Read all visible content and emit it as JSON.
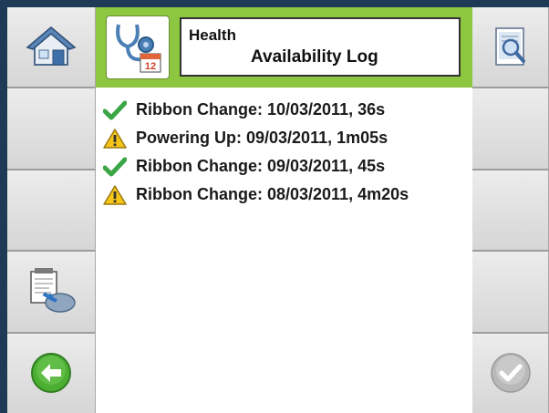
{
  "header": {
    "title_line1": "Health",
    "title_line2": "Availability Log",
    "icon": "stethoscope-calendar-icon",
    "calendar_day": "12"
  },
  "left_buttons": [
    {
      "icon": "home-icon"
    },
    {
      "icon": ""
    },
    {
      "icon": ""
    },
    {
      "icon": "export-log-icon"
    },
    {
      "icon": "back-arrow-icon"
    }
  ],
  "right_buttons": [
    {
      "icon": "document-search-icon"
    },
    {
      "icon": ""
    },
    {
      "icon": ""
    },
    {
      "icon": ""
    },
    {
      "icon": "confirm-check-icon",
      "state": "disabled"
    }
  ],
  "log": {
    "entries": [
      {
        "status": "ok",
        "icon": "green-check-icon",
        "text": "Ribbon Change: 10/03/2011, 36s"
      },
      {
        "status": "warning",
        "icon": "warning-icon",
        "text": "Powering Up: 09/03/2011, 1m05s"
      },
      {
        "status": "ok",
        "icon": "green-check-icon",
        "text": "Ribbon Change: 09/03/2011, 45s"
      },
      {
        "status": "warning",
        "icon": "warning-icon",
        "text": "Ribbon Change: 08/03/2011, 4m20s"
      }
    ]
  },
  "colors": {
    "header_green": "#8dc63f",
    "frame_blue": "#1f3a56",
    "ok_green": "#3aa645",
    "warning_yellow": "#f5c518",
    "back_green": "#4cae33"
  }
}
